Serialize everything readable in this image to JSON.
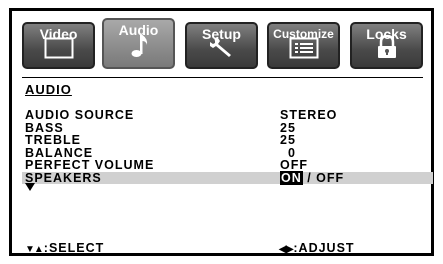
{
  "tabs": [
    {
      "label": "Video",
      "icon": "monitor-icon",
      "active": false
    },
    {
      "label": "Audio",
      "icon": "music-note-icon",
      "active": true
    },
    {
      "label": "Setup",
      "icon": "wrench-icon",
      "active": false
    },
    {
      "label": "Customize",
      "icon": "list-icon",
      "active": false
    },
    {
      "label": "Locks",
      "icon": "padlock-icon",
      "active": false
    }
  ],
  "section_title": "AUDIO",
  "settings": [
    {
      "label": "AUDIO SOURCE",
      "value": "STEREO"
    },
    {
      "label": "BASS",
      "value": "25"
    },
    {
      "label": "TREBLE",
      "value": "25"
    },
    {
      "label": "BALANCE",
      "value": "0"
    },
    {
      "label": "PERFECT VOLUME",
      "value": "OFF"
    },
    {
      "label": "SPEAKERS",
      "value_on": "ON",
      "value_sep": " / ",
      "value_off": "OFF",
      "selected": "ON"
    }
  ],
  "footer": {
    "select_glyph": "▼▲",
    "select_label": ":SELECT",
    "adjust_glyph": "◀▶",
    "adjust_label": ":ADJUST"
  },
  "colors": {
    "highlight": "#d0d0d0",
    "tab_active": "#8b8b8b",
    "tab_inactive": "#4a4a4a"
  }
}
